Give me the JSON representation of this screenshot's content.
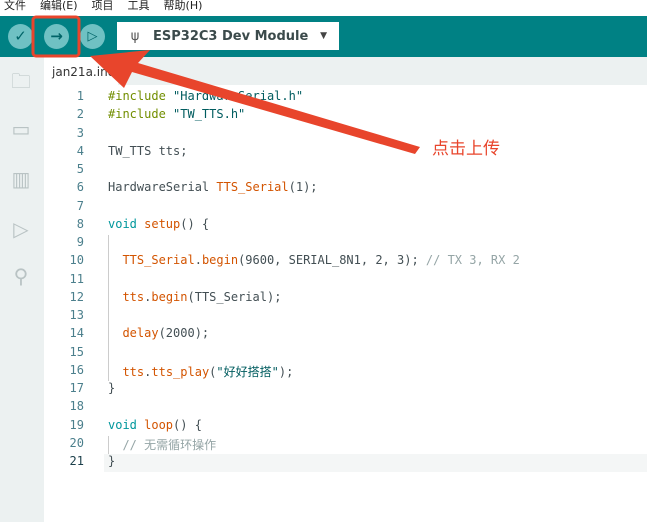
{
  "menu": [
    "文件",
    "编辑(E)",
    "项目",
    "工具",
    "帮助(H)"
  ],
  "toolbar": {
    "verify_icon": "check-icon",
    "upload_icon": "arrow-right-icon",
    "debug_icon": "debug-icon",
    "board": "ESP32C3 Dev Module"
  },
  "tab": "jan21a.ino",
  "annotation": "点击上传",
  "colors": {
    "toolbar": "#008184",
    "annotation": "#e8452c"
  },
  "current_line": 21,
  "lines": [
    [
      [
        "p",
        "#include "
      ],
      [
        "s",
        "\"HardwareSerial.h\""
      ]
    ],
    [
      [
        "p",
        "#include "
      ],
      [
        "s",
        "\"TW_TTS.h\""
      ]
    ],
    [],
    [
      [
        "",
        "TW_TTS tts;"
      ]
    ],
    [],
    [
      [
        "",
        "HardwareSerial "
      ],
      [
        "f",
        "TTS_Serial"
      ],
      [
        "",
        "(1);"
      ]
    ],
    [],
    [
      [
        "k",
        "void "
      ],
      [
        "f",
        "setup"
      ],
      [
        "",
        "() {"
      ]
    ],
    [],
    [
      [
        "",
        "  "
      ],
      [
        "f",
        "TTS_Serial"
      ],
      [
        "",
        "."
      ],
      [
        "f",
        "begin"
      ],
      [
        "",
        "(9600, SERIAL_8N1, 2, 3); "
      ],
      [
        "c",
        "// TX 3, RX 2"
      ]
    ],
    [],
    [
      [
        "",
        "  "
      ],
      [
        "f",
        "tts"
      ],
      [
        "",
        "."
      ],
      [
        "f",
        "begin"
      ],
      [
        "",
        "(TTS_Serial);"
      ]
    ],
    [],
    [
      [
        "",
        "  "
      ],
      [
        "f",
        "delay"
      ],
      [
        "",
        "(2000);"
      ]
    ],
    [],
    [
      [
        "",
        "  "
      ],
      [
        "f",
        "tts"
      ],
      [
        "",
        "."
      ],
      [
        "f",
        "tts_play"
      ],
      [
        "",
        "("
      ],
      [
        "s",
        "\"好好搭搭\""
      ],
      [
        "",
        "); "
      ]
    ],
    [
      [
        "",
        "}"
      ]
    ],
    [],
    [
      [
        "k",
        "void "
      ],
      [
        "f",
        "loop"
      ],
      [
        "",
        "() {"
      ]
    ],
    [
      [
        "c",
        "  // 无需循环操作"
      ]
    ],
    [
      [
        "",
        "}"
      ]
    ]
  ]
}
